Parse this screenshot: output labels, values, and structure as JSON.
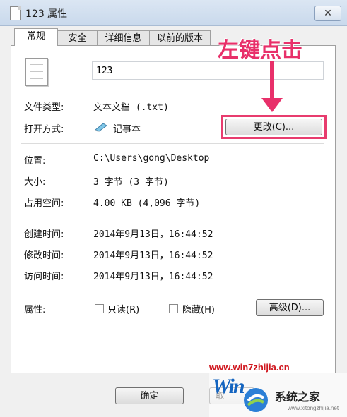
{
  "window": {
    "title": "123 属性",
    "close_label": "✕"
  },
  "tabs": [
    {
      "label": "常规",
      "active": true
    },
    {
      "label": "安全",
      "active": false
    },
    {
      "label": "详细信息",
      "active": false
    },
    {
      "label": "以前的版本",
      "active": false
    }
  ],
  "general": {
    "file_name": "123",
    "file_type_label": "文件类型:",
    "file_type_value": "文本文档 (.txt)",
    "open_with_label": "打开方式:",
    "open_with_value": "记事本",
    "change_button": "更改(C)...",
    "location_label": "位置:",
    "location_value": "C:\\Users\\gong\\Desktop",
    "size_label": "大小:",
    "size_value": "3 字节 (3 字节)",
    "disk_size_label": "占用空间:",
    "disk_size_value": "4.00 KB (4,096 字节)",
    "created_label": "创建时间:",
    "created_value": "2014年9月13日，16:44:52",
    "modified_label": "修改时间:",
    "modified_value": "2014年9月13日，16:44:52",
    "accessed_label": "访问时间:",
    "accessed_value": "2014年9月13日，16:44:52",
    "attributes_label": "属性:",
    "readonly_label": "只读(R)",
    "readonly_checked": false,
    "hidden_label": "隐藏(H)",
    "hidden_checked": false,
    "advanced_button": "高级(D)..."
  },
  "footer": {
    "ok_button": "确定",
    "cancel_button": "取"
  },
  "annotation": {
    "text": "左键点击",
    "color": "#e8306a"
  },
  "watermark": {
    "url": "www.win7zhijia.cn",
    "win_text": "Win",
    "site_name": "系统之家",
    "small_text": "www.xitongzhijia.net"
  }
}
